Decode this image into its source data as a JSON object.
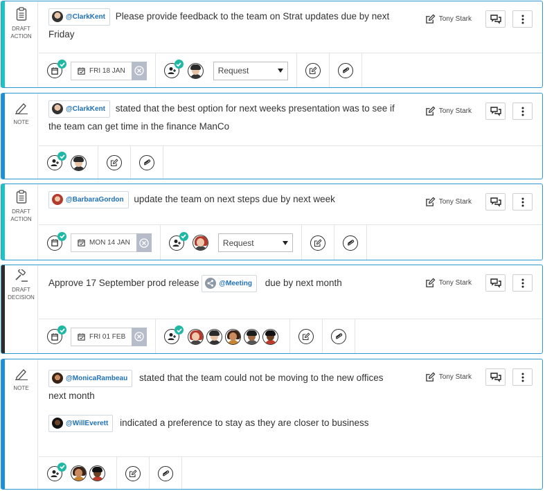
{
  "cards": [
    {
      "type_label_1": "DRAFT",
      "type_label_2": "ACTION",
      "mention": "@ClarkKent",
      "text_line1": "Please provide feedback to the team on Strat updates due by next",
      "text_line2": "Friday",
      "owner": "Tony Stark",
      "due_date": "FRI 18 JAN",
      "select_value": "Request"
    },
    {
      "type_label_1": "NOTE",
      "mention": "@ClarkKent",
      "text_line1": "stated that the best option for next weeks presentation was to see if",
      "text_line2": "the team can get time in the finance ManCo",
      "owner": "Tony Stark"
    },
    {
      "type_label_1": "DRAFT",
      "type_label_2": "ACTION",
      "mention": "@BarbaraGordon",
      "text_line1": "update the team on next steps due by next week",
      "owner": "Tony Stark",
      "due_date": "MON 14 JAN",
      "select_value": "Request"
    },
    {
      "type_label_1": "DRAFT",
      "type_label_2": "DECISION",
      "text_before": "Approve 17 September prod release",
      "mention": "@Meeting",
      "text_after": "due by next month",
      "owner": "Tony Stark",
      "due_date": "FRI 01 FEB"
    },
    {
      "type_label_1": "NOTE",
      "mention": "@MonicaRambeau",
      "text_line1": "stated that the team could not be moving to the new offices",
      "text_line2": "next month",
      "mention2": "@WillEverett",
      "text_line3": "indicated a preference to stay as they are closer to business",
      "owner": "Tony Stark"
    }
  ],
  "icons": {
    "clipboard": "clipboard-icon",
    "pen": "pen-icon",
    "gavel": "gavel-icon",
    "edit": "edit-icon",
    "comment": "comment-icon",
    "more": "more-vertical-icon",
    "calendar": "calendar-check-icon",
    "assign": "assign-user-icon",
    "attach": "paperclip-icon",
    "clear": "clear-date-icon"
  },
  "colors": {
    "action_stripe": "#1cc5c4",
    "note_stripe": "#1b8fd8",
    "decision_stripe": "#2c2c2c",
    "border": "#2d9ad8",
    "check": "#1fb8a4",
    "mention_text": "#1e70b8"
  }
}
